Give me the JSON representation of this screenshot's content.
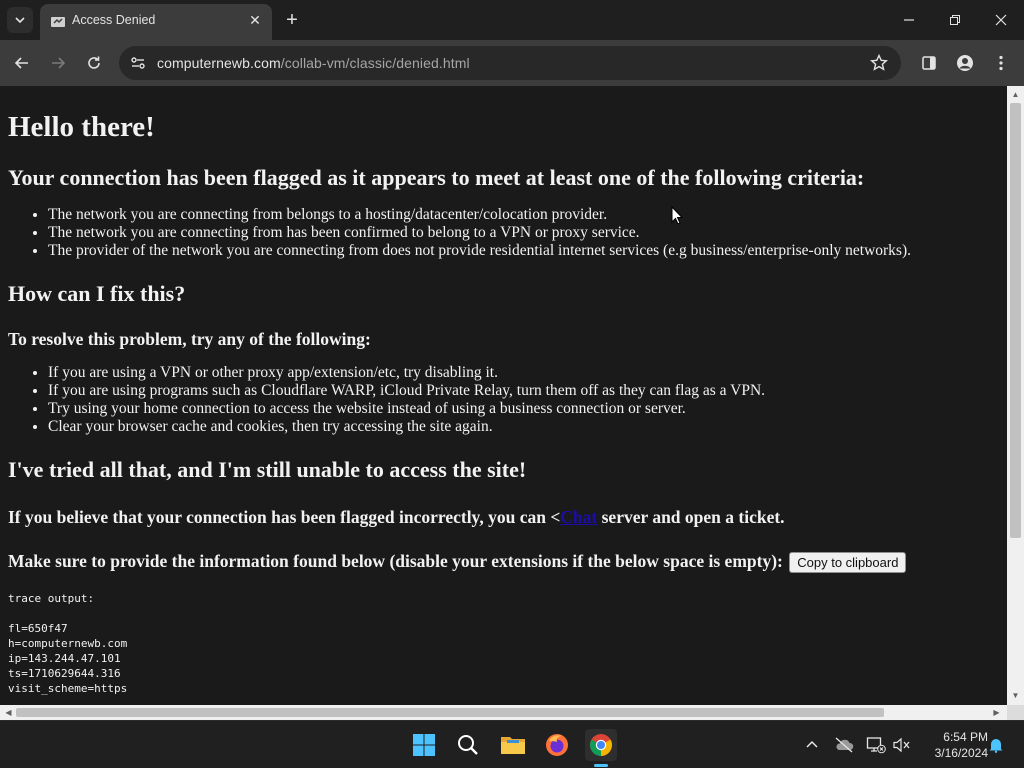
{
  "browser": {
    "tab": {
      "title": "Access Denied",
      "close_symbol": "✕"
    },
    "new_tab_symbol": "+",
    "address": {
      "host": "computernewb.com",
      "path": "/collab-vm/classic/denied.html"
    }
  },
  "page": {
    "heading": "Hello there!",
    "criteria_heading": "Your connection has been flagged as it appears to meet at least one of the following criteria:",
    "criteria": [
      "The network you are connecting from belongs to a hosting/datacenter/colocation provider.",
      "The network you are connecting from has been confirmed to belong to a VPN or proxy service.",
      "The provider of the network you are connecting from does not provide residential internet services (e.g business/enterprise-only networks)."
    ],
    "fix_heading": "How can I fix this?",
    "resolve_heading": "To resolve this problem, try any of the following:",
    "fixes": [
      "If you are using a VPN or other proxy app/extension/etc, try disabling it.",
      "If you are using programs such as Cloudflare WARP, iCloud Private Relay, turn them off as they can flag as a VPN.",
      "Try using your home connection to access the website instead of using a business connection or server.",
      "Clear your browser cache and cookies, then try accessing the site again."
    ],
    "tried_heading": "I've tried all that, and I'm still unable to access the site!",
    "incorrect_before": "If you believe that your connection has been flagged incorrectly, you can <",
    "incorrect_link": "Chat",
    "incorrect_after": " server and open a ticket.",
    "provide_text": "Make sure to provide the information found below (disable your extensions if the below space is empty):",
    "copy_button": "Copy to clipboard",
    "trace_label": "trace output:",
    "trace_lines": [
      "fl=650f47",
      "h=computernewb.com",
      "ip=143.244.47.101",
      "ts=1710629644.316",
      "visit_scheme=https"
    ]
  },
  "taskbar": {
    "time": "6:54 PM",
    "date": "3/16/2024"
  },
  "colors": {
    "page_bg": "#1a1a1a",
    "link": "#1a0dab",
    "chrome_toolbar": "#3c3c3c",
    "taskbar": "#202020",
    "accent": "#4cc2ff"
  }
}
